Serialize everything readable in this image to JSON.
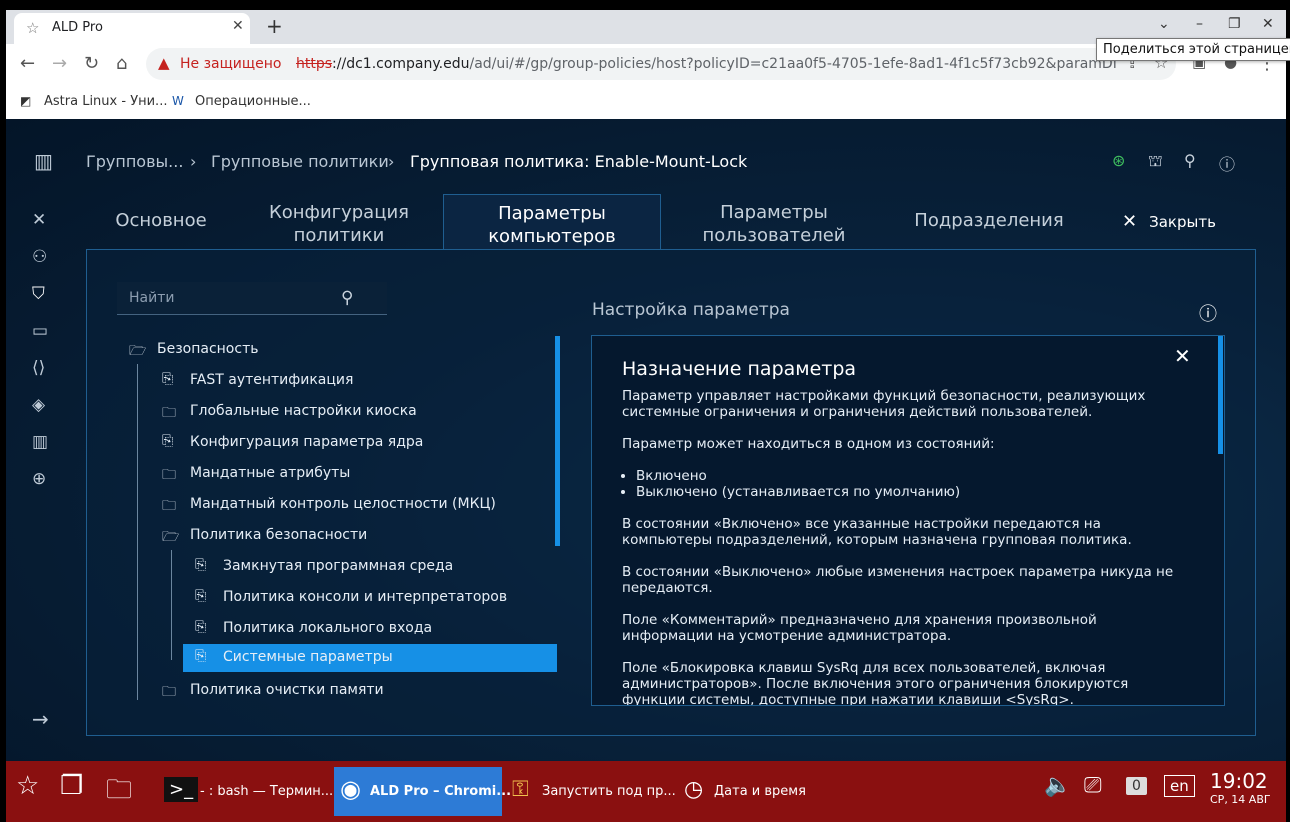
{
  "browser": {
    "tab_title": "ALD Pro",
    "tab_close": "✕",
    "new_tab": "+",
    "window_buttons": [
      "⌄",
      "–",
      "❐",
      "✕"
    ],
    "security_label": "Не защищено",
    "url_scheme": "https",
    "url_host": "://dc1.company.edu",
    "url_path": "/ad/ui/#/gp/group-policies/host?policyID=c21aa0f5-4705-1efe-8ad1-4f1c5f73cb92&paramDN=c...",
    "tooltip": "Поделиться этой страницей",
    "bookmarks": [
      {
        "label": "Astra Linux - Уни..."
      },
      {
        "label": "Операционные..."
      }
    ]
  },
  "app": {
    "breadcrumbs": [
      "Групповы...",
      "Групповые политики",
      "Групповая политика: Enable-Mount-Lock"
    ],
    "breadcrumb_sep": "›",
    "tabs": [
      {
        "label": "Основное",
        "active": false
      },
      {
        "label": "Конфигурация политики",
        "active": false
      },
      {
        "label": "Параметры компьютеров",
        "active": true
      },
      {
        "label": "Параметры пользователей",
        "active": false
      },
      {
        "label": "Подразделения",
        "active": false
      }
    ],
    "close_label": "Закрыть",
    "search_placeholder": "Найти",
    "tree": [
      {
        "label": "Безопасность",
        "type": "folder-open",
        "level": 0
      },
      {
        "label": "FAST аутентификация",
        "type": "param",
        "level": 1
      },
      {
        "label": "Глобальные настройки киоска",
        "type": "folder",
        "level": 1
      },
      {
        "label": "Конфигурация параметра ядра",
        "type": "param",
        "level": 1
      },
      {
        "label": "Мандатные атрибуты",
        "type": "folder",
        "level": 1
      },
      {
        "label": "Мандатный контроль целостности (МКЦ)",
        "type": "folder",
        "level": 1
      },
      {
        "label": "Политика безопасности",
        "type": "folder-open",
        "level": 1
      },
      {
        "label": "Замкнутая программная среда",
        "type": "param",
        "level": 2
      },
      {
        "label": "Политика консоли и интерпретаторов",
        "type": "param",
        "level": 2
      },
      {
        "label": "Политика локального входа",
        "type": "param",
        "level": 2
      },
      {
        "label": "Системные параметры",
        "type": "param",
        "level": 2,
        "selected": true
      },
      {
        "label": "Политика очистки памяти",
        "type": "folder",
        "level": 1
      }
    ],
    "settings_title": "Настройка параметра",
    "desc": {
      "heading": "Назначение параметра",
      "p1": "Параметр управляет настройками функций безопасности, реализующих системные ограничения и ограничения действий пользователей.",
      "p2": "Параметр может находиться в одном из состояний:",
      "li1": "Включено",
      "li2": "Выключено (устанавливается по умолчанию)",
      "p3": "В состоянии «Включено» все указанные настройки передаются на компьютеры подразделений, которым назначена групповая политика.",
      "p4": "В состоянии «Выключено» любые изменения настроек параметра никуда не передаются.",
      "p5": "Поле «Комментарий» предназначено для хранения произвольной информации на усмотрение администратора.",
      "p6": "Поле «Блокировка клавиш SysRq для всех пользователей, включая администраторов». После включения этого ограничения блокируются функции системы, доступные при нажатии клавиши <SysRq>."
    }
  },
  "taskbar": {
    "items": [
      {
        "label": "- : bash — Термин..."
      },
      {
        "label": "ALD Pro – Chromi...",
        "active": true
      },
      {
        "label": "Запустить под пр..."
      },
      {
        "label": "Дата и время"
      }
    ],
    "counter": "0",
    "lang": "en",
    "time": "19:02",
    "date": "СР, 14 АВГ"
  },
  "colors": {
    "accent": "#1690e6",
    "taskbar": "#8a1010",
    "app_bg": "#08213a"
  }
}
